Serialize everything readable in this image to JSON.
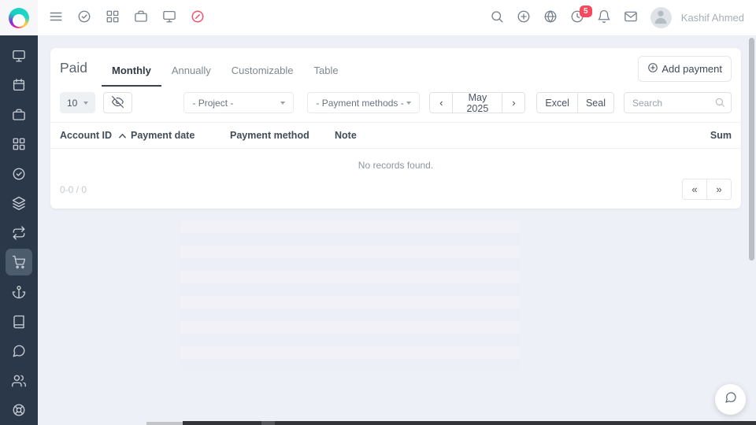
{
  "colors": {
    "accent_pink": "#f4516c",
    "badge_red": "#f8485e",
    "sidebar_bg": "#2b3849",
    "sidebar_active_bg": "#4d5c6d",
    "page_bg": "#edf0f6",
    "card_bg": "#ffffff"
  },
  "topbar": {
    "user_name": "Kashif Ahmed",
    "notifications": {
      "count": "5"
    },
    "left_icons": [
      "menu-icon",
      "check-circle-icon",
      "grid-icon",
      "briefcase-icon",
      "monitor-icon",
      "timer-icon"
    ],
    "right_icons": [
      "search-icon",
      "plus-circle-icon",
      "globe-icon",
      "clock-icon",
      "bell-icon",
      "mail-icon",
      "avatar"
    ]
  },
  "sidebar": {
    "icons": [
      "monitor",
      "calendar",
      "briefcase",
      "grid",
      "check-circle",
      "layers",
      "repeat",
      "shopping-cart",
      "anchor",
      "book",
      "message-circle",
      "users",
      "life-buoy"
    ],
    "active_item": "shopping-cart"
  },
  "page": {
    "title": "Paid",
    "tabs": [
      {
        "label": "Monthly",
        "active": true
      },
      {
        "label": "Annually",
        "active": false
      },
      {
        "label": "Customizable",
        "active": false
      },
      {
        "label": "Table",
        "active": false
      }
    ],
    "add_payment_label": "Add payment"
  },
  "filters": {
    "page_size": "10",
    "project": "- Project -",
    "payment_methods": "- Payment methods -",
    "month": "May 2025",
    "prev_label": "‹",
    "next_label": "›",
    "export_excel": "Excel",
    "export_seal": "Seal",
    "search_placeholder": "Search"
  },
  "table": {
    "columns": [
      "Account ID",
      "Payment date",
      "Payment method",
      "Note",
      "Sum"
    ],
    "empty_message": "No records found.",
    "range_label": "0-0 / 0",
    "pager_prev": "«",
    "pager_next": "»"
  }
}
